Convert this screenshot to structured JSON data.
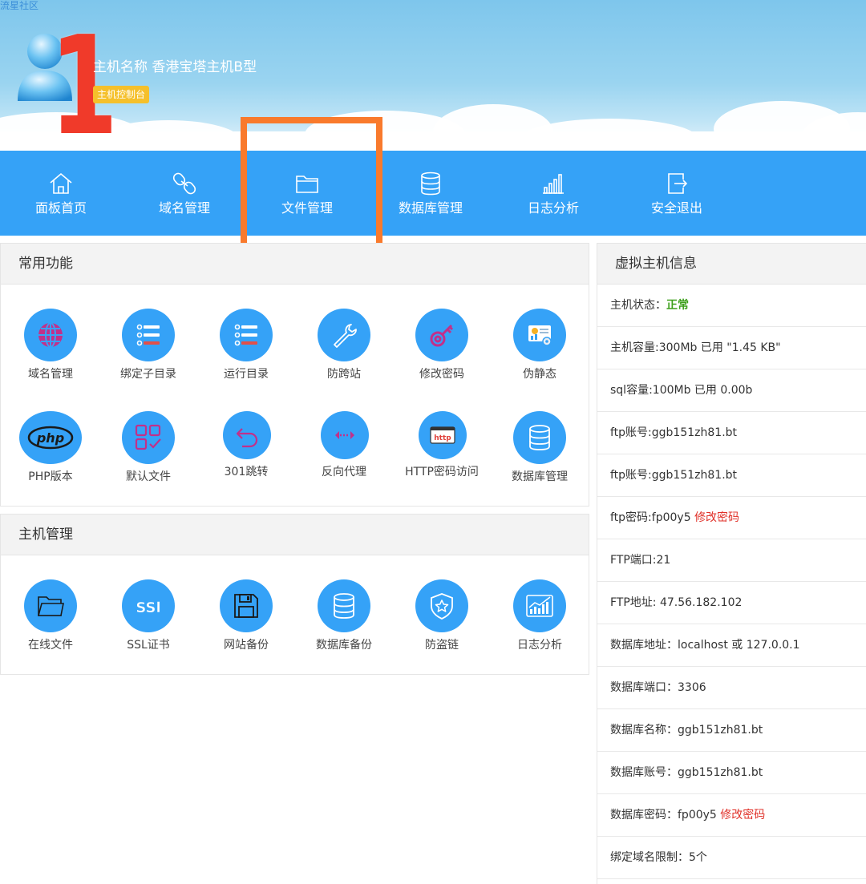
{
  "header": {
    "site_link": "流星社区",
    "host_label": "主机名称",
    "host_name": "香港宝塔主机B型",
    "badge": "主机控制台",
    "marker": "1"
  },
  "nav": {
    "items": [
      {
        "label": "面板首页",
        "icon": "home-icon"
      },
      {
        "label": "域名管理",
        "icon": "link-icon"
      },
      {
        "label": "文件管理",
        "icon": "folder-icon"
      },
      {
        "label": "数据库管理",
        "icon": "database-icon"
      },
      {
        "label": "日志分析",
        "icon": "bar-chart-icon"
      },
      {
        "label": "安全退出",
        "icon": "logout-icon"
      }
    ]
  },
  "common": {
    "title": "常用功能",
    "items": [
      {
        "label": "域名管理",
        "icon": "globe-icon"
      },
      {
        "label": "绑定子目录",
        "icon": "list-icon"
      },
      {
        "label": "运行目录",
        "icon": "list-icon"
      },
      {
        "label": "防跨站",
        "icon": "wrench-icon"
      },
      {
        "label": "修改密码",
        "icon": "key-icon"
      },
      {
        "label": "伪静态",
        "icon": "monitor-gear-icon"
      },
      {
        "label": "PHP版本",
        "icon": "php-icon"
      },
      {
        "label": "默认文件",
        "icon": "grid-check-icon"
      },
      {
        "label": "301跳转",
        "icon": "redirect-icon"
      },
      {
        "label": "反向代理",
        "icon": "proxy-arrows-icon"
      },
      {
        "label": "HTTP密码访问",
        "icon": "http-icon"
      },
      {
        "label": "数据库管理",
        "icon": "database-icon"
      }
    ]
  },
  "host": {
    "title": "主机管理",
    "items": [
      {
        "label": "在线文件",
        "icon": "folder-icon"
      },
      {
        "label": "SSL证书",
        "icon": "ssl-icon"
      },
      {
        "label": "网站备份",
        "icon": "floppy-icon"
      },
      {
        "label": "数据库备份",
        "icon": "database-icon"
      },
      {
        "label": "防盗链",
        "icon": "shield-star-icon"
      },
      {
        "label": "日志分析",
        "icon": "chart-icon"
      }
    ]
  },
  "info": {
    "title": "虚拟主机信息",
    "status_label": "主机状态：",
    "status_value": "正常",
    "rows": [
      "主机容量:300Mb 已用 \"1.45 KB\"",
      "sql容量:100Mb 已用 0.00b",
      "ftp账号:ggb151zh81.bt",
      "ftp账号:ggb151zh81.bt"
    ],
    "ftp_password": "ftp密码:fp00y5",
    "change_password": "修改密码",
    "rows2": [
      "FTP端口:21",
      "FTP地址: 47.56.182.102",
      "数据库地址：localhost 或 127.0.0.1",
      "数据库端口：3306",
      "数据库名称：ggb151zh81.bt",
      "数据库账号：ggb151zh81.bt"
    ],
    "db_password": "数据库密码：fp00y5",
    "change_password2": "修改密码",
    "domain_limit": "绑定域名限制：5个"
  },
  "colors": {
    "nav_blue": "#35a2f7",
    "highlight": "#f97a2c",
    "marker_red": "#f03a2a",
    "badge_yellow": "#f5c02b",
    "status_green": "#3ea01c",
    "link_red": "#e03028"
  }
}
